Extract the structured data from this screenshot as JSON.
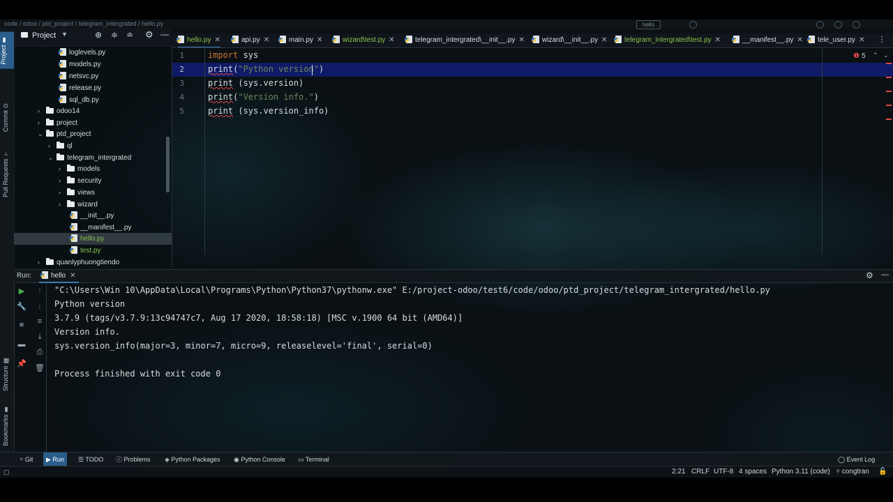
{
  "top_strip": {
    "breadcrumb": "code / odoo / ptd_project / telegram_intergrated / hello.py",
    "run_config": "hello"
  },
  "left_stripe": {
    "items": [
      {
        "label": "Project",
        "icon": "folder-icon"
      },
      {
        "label": "Commit",
        "icon": "commit-icon"
      },
      {
        "label": "Pull Requests",
        "icon": "pull-request-icon"
      },
      {
        "label": "Structure",
        "icon": "structure-icon"
      },
      {
        "label": "Bookmarks",
        "icon": "bookmark-icon"
      }
    ]
  },
  "project_panel": {
    "title": "Project",
    "tree": [
      {
        "label": "loglevels.py",
        "type": "file",
        "depth": 3
      },
      {
        "label": "models.py",
        "type": "file",
        "depth": 3
      },
      {
        "label": "netsvc.py",
        "type": "file",
        "depth": 3
      },
      {
        "label": "release.py",
        "type": "file",
        "depth": 3
      },
      {
        "label": "sql_db.py",
        "type": "file",
        "depth": 3
      },
      {
        "label": "odoo14",
        "type": "folder",
        "depth": 1,
        "chevron": "›"
      },
      {
        "label": "project",
        "type": "folder",
        "depth": 1,
        "chevron": "›"
      },
      {
        "label": "ptd_project",
        "type": "folder",
        "depth": 1,
        "chevron": "⌄"
      },
      {
        "label": "ql",
        "type": "folder",
        "depth": 2,
        "chevron": "›"
      },
      {
        "label": "telegram_intergrated",
        "type": "folder",
        "depth": 2,
        "chevron": "⌄"
      },
      {
        "label": "models",
        "type": "folder",
        "depth": 3,
        "chevron": "›"
      },
      {
        "label": "security",
        "type": "folder",
        "depth": 3,
        "chevron": "›"
      },
      {
        "label": "views",
        "type": "folder",
        "depth": 3,
        "chevron": "›"
      },
      {
        "label": "wizard",
        "type": "folder",
        "depth": 3,
        "chevron": "›"
      },
      {
        "label": "__init__.py",
        "type": "file",
        "depth": 4
      },
      {
        "label": "__manifest__.py",
        "type": "file",
        "depth": 4
      },
      {
        "label": "hello.py",
        "type": "file",
        "depth": 4,
        "selected": true,
        "vcs": "added"
      },
      {
        "label": "test.py",
        "type": "file",
        "depth": 4,
        "vcs": "added"
      },
      {
        "label": "quanlyphuongtiendo",
        "type": "folder",
        "depth": 1,
        "chevron": "›"
      }
    ]
  },
  "editor_tabs": [
    {
      "label": "hello.py",
      "active": true,
      "vcs": "added"
    },
    {
      "label": "api.py"
    },
    {
      "label": "main.py"
    },
    {
      "label": "wizard\\test.py",
      "vcs": "added"
    },
    {
      "label": "telegram_intergrated\\__init__.py"
    },
    {
      "label": "wizard\\__init__.py"
    },
    {
      "label": "telegram_intergrated\\test.py",
      "vcs": "added"
    },
    {
      "label": "__manifest__.py"
    },
    {
      "label": "tele_user.py"
    }
  ],
  "editor": {
    "error_count": "5",
    "lines": [
      {
        "num": "1",
        "tokens": [
          {
            "t": "import",
            "c": "kw"
          },
          {
            "t": " sys",
            "c": ""
          }
        ]
      },
      {
        "num": "2",
        "tokens": [
          {
            "t": "print",
            "c": "squig"
          },
          {
            "t": "(",
            "c": ""
          },
          {
            "t": "\"Python version\"",
            "c": "str"
          },
          {
            "t": ")",
            "c": ""
          }
        ]
      },
      {
        "num": "3",
        "tokens": [
          {
            "t": "print",
            "c": "squig"
          },
          {
            "t": " (sys.version)",
            "c": ""
          }
        ]
      },
      {
        "num": "4",
        "tokens": [
          {
            "t": "print",
            "c": "squig"
          },
          {
            "t": "(",
            "c": ""
          },
          {
            "t": "\"Version info.\"",
            "c": "str"
          },
          {
            "t": ")",
            "c": ""
          }
        ]
      },
      {
        "num": "5",
        "tokens": [
          {
            "t": "print",
            "c": "squig"
          },
          {
            "t": " (sys.version_info)",
            "c": ""
          }
        ]
      }
    ]
  },
  "run_panel": {
    "label": "Run:",
    "tab": "hello",
    "output": [
      "\"C:\\Users\\Win 10\\AppData\\Local\\Programs\\Python\\Python37\\pythonw.exe\" E:/project-odoo/test6/code/odoo/ptd_project/telegram_intergrated/hello.py",
      "Python version",
      "3.7.9 (tags/v3.7.9:13c94747c7, Aug 17 2020, 18:58:18) [MSC v.1900 64 bit (AMD64)]",
      "Version info.",
      "sys.version_info(major=3, minor=7, micro=9, releaselevel='final', serial=0)",
      "",
      "Process finished with exit code 0"
    ]
  },
  "tool_windows": [
    {
      "label": "Git",
      "icon": "git-icon"
    },
    {
      "label": "Run",
      "icon": "run-icon",
      "active": true
    },
    {
      "label": "TODO",
      "icon": "todo-icon"
    },
    {
      "label": "Problems",
      "icon": "problems-icon"
    },
    {
      "label": "Python Packages",
      "icon": "packages-icon"
    },
    {
      "label": "Python Console",
      "icon": "python-console-icon"
    },
    {
      "label": "Terminal",
      "icon": "terminal-icon"
    }
  ],
  "event_log": "Event Log",
  "status_bar": {
    "position": "2:21",
    "line_sep": "CRLF",
    "encoding": "UTF-8",
    "indent": "4 spaces",
    "interpreter": "Python 3.11 (code)",
    "branch": "congtran"
  },
  "colors": {
    "accent": "#2b5d8a",
    "current_line": "#101c6e",
    "keyword": "#cc7832",
    "string": "#6a8759",
    "error": "#e04848",
    "vcs_added": "#8bc34a"
  }
}
